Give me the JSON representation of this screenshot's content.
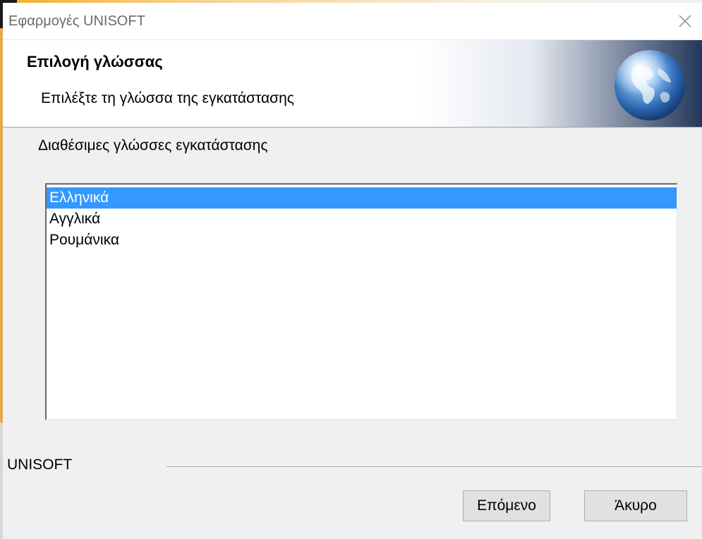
{
  "window": {
    "title": "Εφαρμογές UNISOFT",
    "close_icon": "close-icon"
  },
  "header": {
    "title": "Επιλογή γλώσσας",
    "subtitle": "Επιλέξτε τη γλώσσα της εγκατάστασης",
    "logo_icon": "globe-icon"
  },
  "main": {
    "section_label": "Διαθέσιμες γλώσσες εγκατάστασης",
    "languages": [
      {
        "label": "Ελληνικά",
        "selected": true
      },
      {
        "label": "Αγγλικά",
        "selected": false
      },
      {
        "label": "Ρουμάνικα",
        "selected": false
      }
    ]
  },
  "footer": {
    "brand": "UNISOFT",
    "next_label": "Επόμενο",
    "cancel_label": "Άκυρο"
  },
  "colors": {
    "selection": "#3399ff",
    "banner_dark": "#24375a",
    "window_bg": "#f0f0f0"
  }
}
